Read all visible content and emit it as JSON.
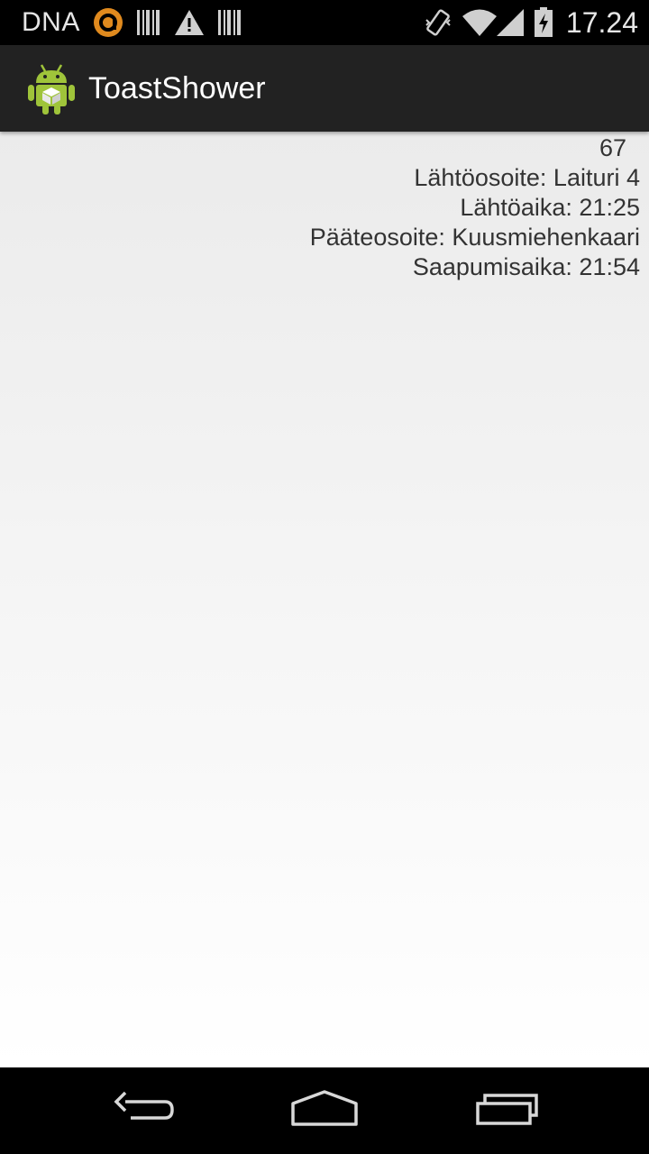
{
  "status_bar": {
    "carrier": "DNA",
    "time": "17.24",
    "icons": [
      "carrier-app-icon",
      "barcode-icon",
      "warning-icon",
      "barcode-icon",
      "vibrate-icon",
      "wifi-icon",
      "signal-icon",
      "battery-charging-icon"
    ]
  },
  "action_bar": {
    "app_icon": "android-robot-icon",
    "title": "ToastShower"
  },
  "content": {
    "route_number": "67",
    "departure_address": "Lähtöosoite: Laituri 4",
    "departure_time": "Lähtöaika: 21:25",
    "destination_address": "Pääteosoite: Kuusmiehenkaari",
    "arrival_time": "Saapumisaika: 21:54"
  },
  "nav_bar": {
    "icons": [
      "back-icon",
      "home-icon",
      "recent-apps-icon"
    ]
  },
  "colors": {
    "status_bar_bg": "#000000",
    "action_bar_bg": "#222222",
    "text": "#333333",
    "accent_orange": "#e08a1e",
    "android_green": "#9fc43a"
  }
}
